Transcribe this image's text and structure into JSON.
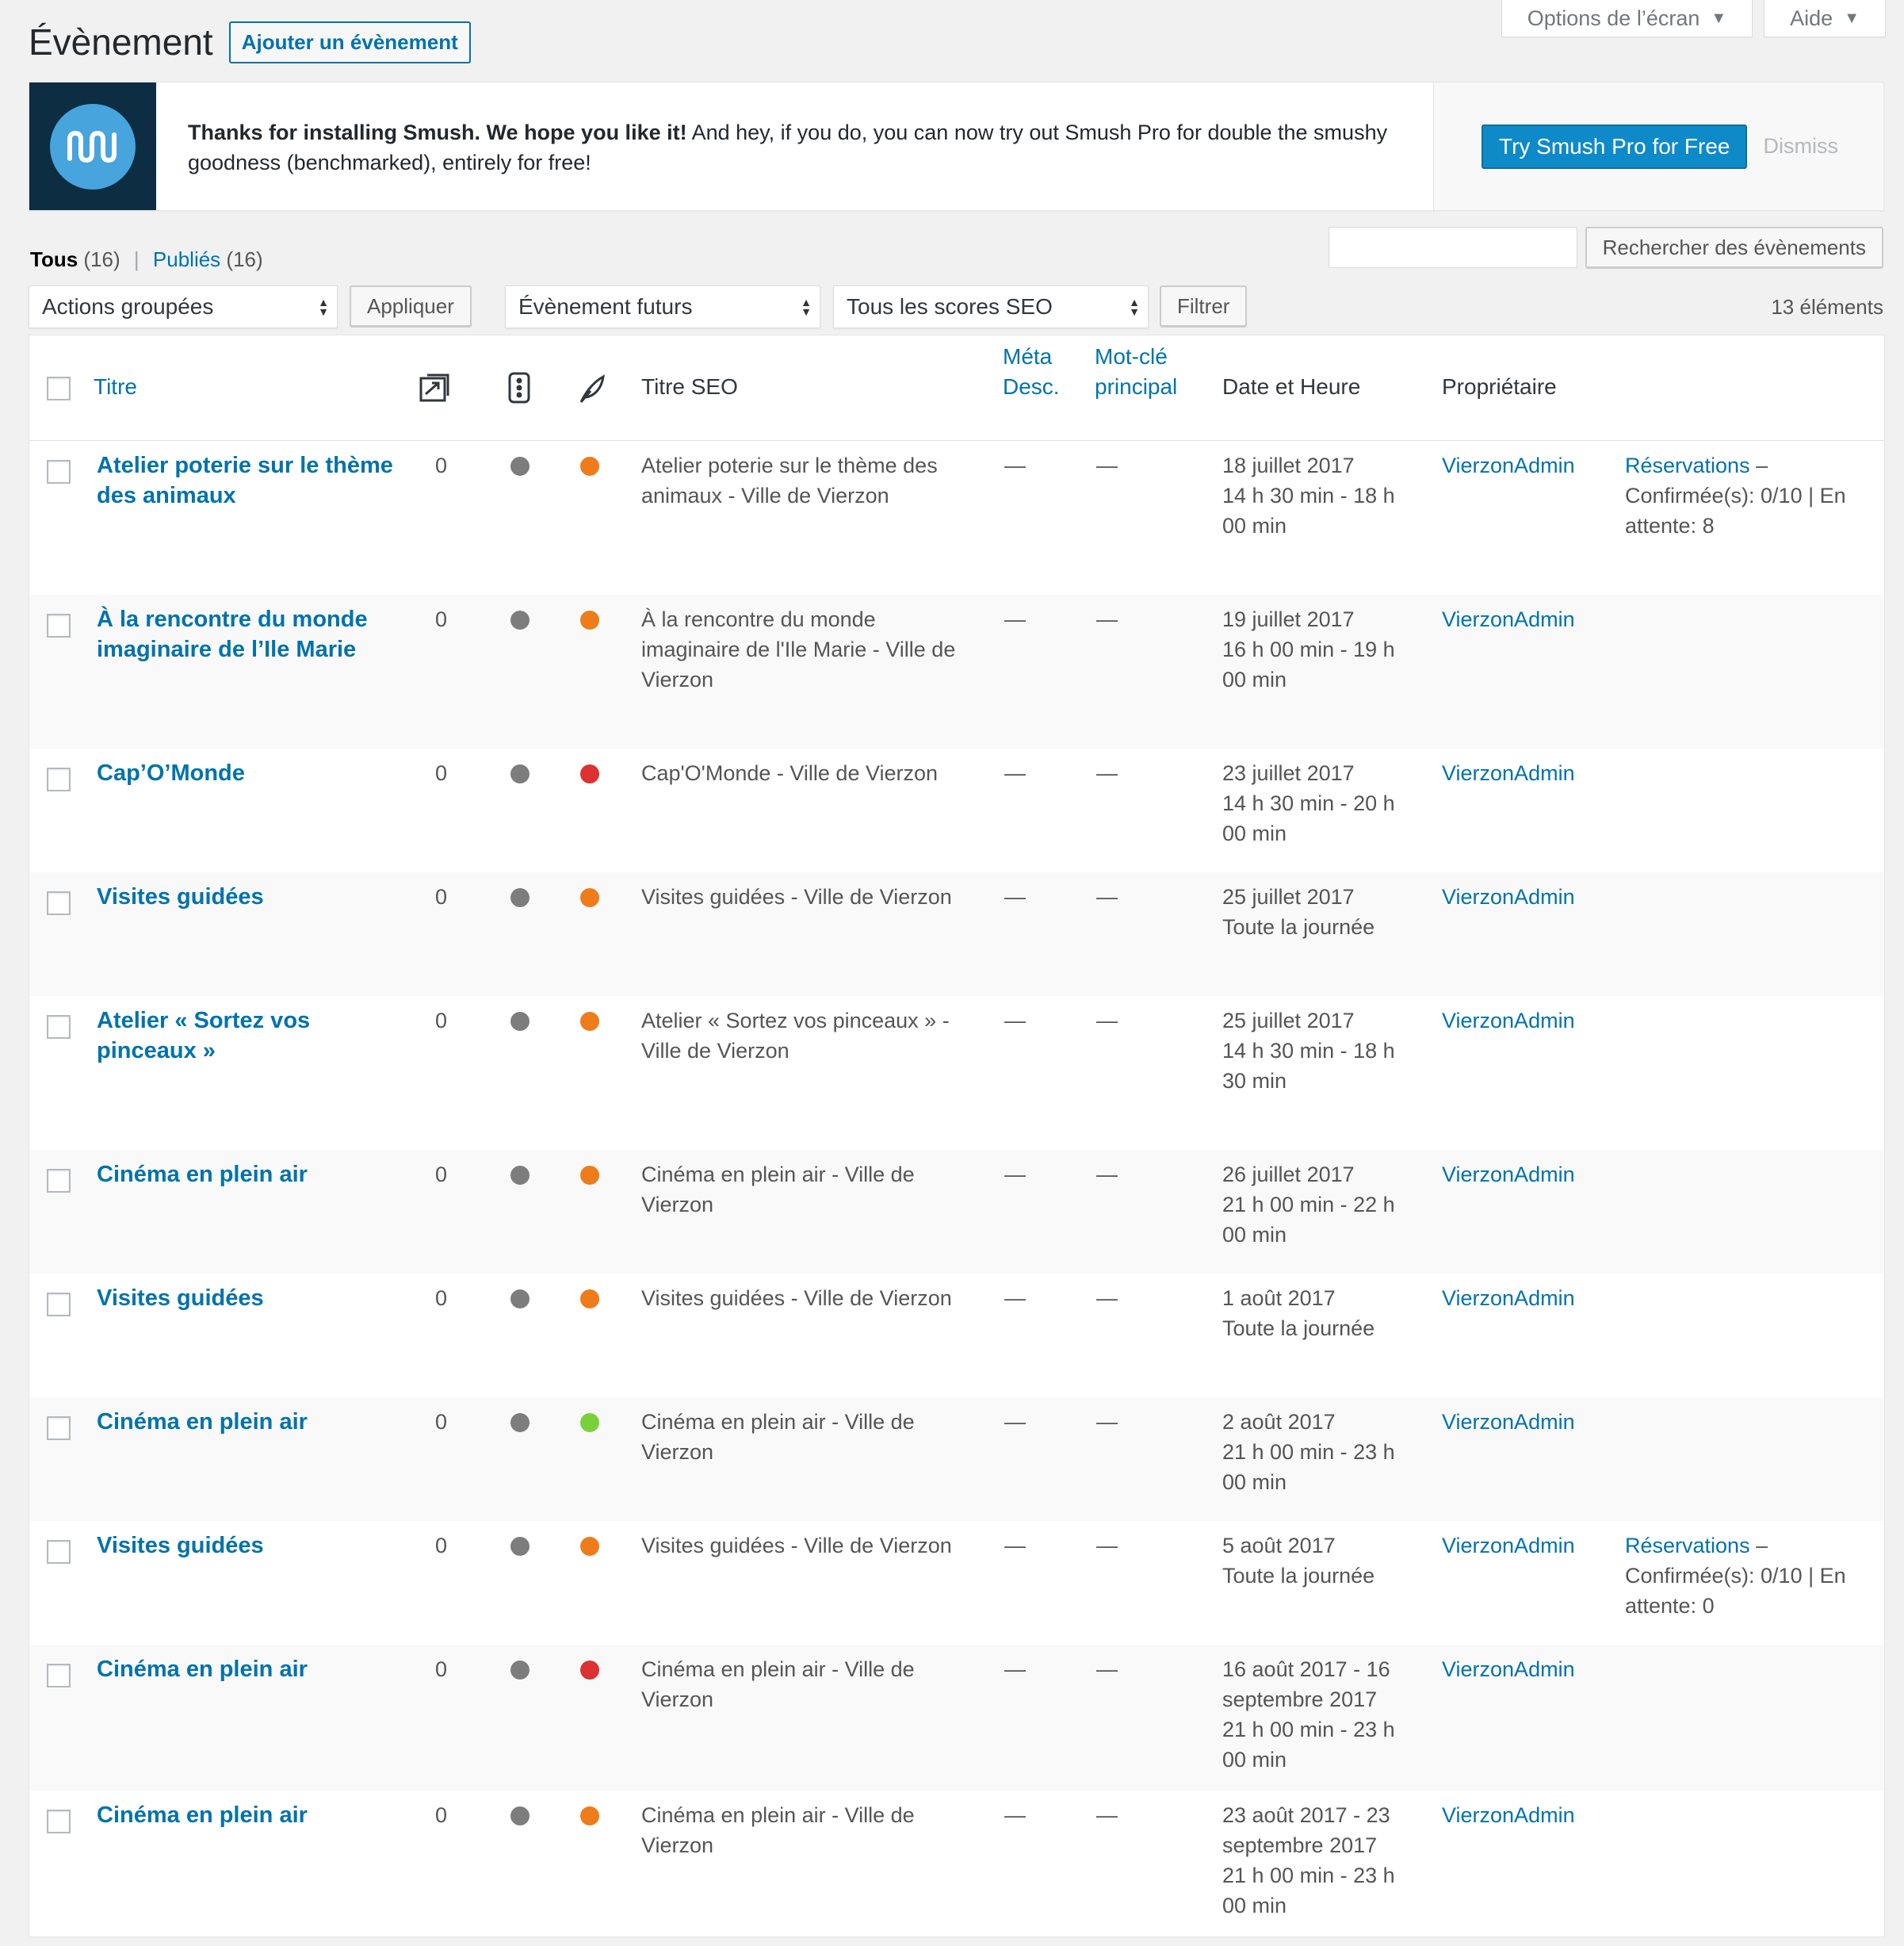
{
  "screen_meta": {
    "options_label": "Options de l’écran",
    "help_label": "Aide"
  },
  "header": {
    "title": "Évènement",
    "add_new_label": "Ajouter un évènement"
  },
  "notice": {
    "bold_text": "Thanks for installing Smush. We hope you like it!",
    "text": " And hey, if you do, you can now try out Smush Pro for double the smushy goodness (benchmarked), entirely for free!",
    "try_button": "Try Smush Pro for Free",
    "dismiss_label": "Dismiss"
  },
  "views": {
    "all_label": "Tous",
    "all_count": "(16)",
    "sep": "|",
    "published_label": "Publiés",
    "published_count": "(16)"
  },
  "search": {
    "value": "",
    "button_label": "Rechercher des évènements"
  },
  "tablenav": {
    "bulk_actions": "Actions groupées",
    "apply_label": "Appliquer",
    "event_filter": "Évènement futurs",
    "seo_filter": "Tous les scores SEO",
    "filter_label": "Filtrer",
    "items_count": "13 éléments"
  },
  "columns": {
    "title": "Titre",
    "links_icon": "link-count-icon",
    "readability_icon": "traffic-light-icon",
    "seo_icon": "feather-icon",
    "seo_title": "Titre SEO",
    "meta_desc_1": "Méta",
    "meta_desc_2": "Desc.",
    "focus_kw_1": "Mot-clé",
    "focus_kw_2": "principal",
    "date": "Date et Heure",
    "owner": "Propriétaire"
  },
  "colors": {
    "gray": "#7d7d7d",
    "orange": "#ee7c1b",
    "red": "#dc3232",
    "green": "#7ad03a",
    "link": "#0073aa"
  },
  "rows": [
    {
      "title_1": "Atelier poterie sur le thème",
      "title_2": "des animaux",
      "links": "0",
      "readability": "gray",
      "seo": "orange",
      "seo_1": "Atelier poterie sur le thème des",
      "seo_2": "animaux - Ville de Vierzon",
      "seo_3": "",
      "meta": "—",
      "kw": "—",
      "date_1": "18 juillet 2017",
      "date_2": "14 h 30 min - 18 h",
      "date_3": "00 min",
      "date_4": "",
      "owner": "VierzonAdmin",
      "res_link": "Réservations",
      "res_1": " –",
      "res_2": "Confirmée(s): 0/10 | En",
      "res_3": "attente: 8"
    },
    {
      "title_1": "À la rencontre du monde",
      "title_2": "imaginaire de l’Ile Marie",
      "links": "0",
      "readability": "gray",
      "seo": "orange",
      "seo_1": "À la rencontre du monde",
      "seo_2": "imaginaire de l'Ile Marie - Ville de",
      "seo_3": "Vierzon",
      "meta": "—",
      "kw": "—",
      "date_1": "19 juillet 2017",
      "date_2": "16 h 00 min - 19 h",
      "date_3": "00 min",
      "date_4": "",
      "owner": "VierzonAdmin",
      "res_link": "",
      "res_1": "",
      "res_2": "",
      "res_3": ""
    },
    {
      "title_1": "Cap’O’Monde",
      "title_2": "",
      "links": "0",
      "readability": "gray",
      "seo": "red",
      "seo_1": "Cap'O'Monde - Ville de Vierzon",
      "seo_2": "",
      "seo_3": "",
      "meta": "—",
      "kw": "—",
      "date_1": "23 juillet 2017",
      "date_2": "14 h 30 min - 20 h",
      "date_3": "00 min",
      "date_4": "",
      "owner": "VierzonAdmin",
      "res_link": "",
      "res_1": "",
      "res_2": "",
      "res_3": ""
    },
    {
      "title_1": "Visites guidées",
      "title_2": "",
      "links": "0",
      "readability": "gray",
      "seo": "orange",
      "seo_1": "Visites guidées - Ville de Vierzon",
      "seo_2": "",
      "seo_3": "",
      "meta": "—",
      "kw": "—",
      "date_1": "25 juillet 2017",
      "date_2": "Toute la journée",
      "date_3": "",
      "date_4": "",
      "owner": "VierzonAdmin",
      "res_link": "",
      "res_1": "",
      "res_2": "",
      "res_3": ""
    },
    {
      "title_1": "Atelier « Sortez vos",
      "title_2": "pinceaux »",
      "links": "0",
      "readability": "gray",
      "seo": "orange",
      "seo_1": "Atelier « Sortez vos pinceaux » -",
      "seo_2": "Ville de Vierzon",
      "seo_3": "",
      "meta": "—",
      "kw": "—",
      "date_1": "25 juillet 2017",
      "date_2": "14 h 30 min - 18 h",
      "date_3": "30 min",
      "date_4": "",
      "owner": "VierzonAdmin",
      "res_link": "",
      "res_1": "",
      "res_2": "",
      "res_3": ""
    },
    {
      "title_1": "Cinéma en plein air",
      "title_2": "",
      "links": "0",
      "readability": "gray",
      "seo": "orange",
      "seo_1": "Cinéma en plein air - Ville de",
      "seo_2": "Vierzon",
      "seo_3": "",
      "meta": "—",
      "kw": "—",
      "date_1": "26 juillet 2017",
      "date_2": "21 h 00 min - 22 h",
      "date_3": "00 min",
      "date_4": "",
      "owner": "VierzonAdmin",
      "res_link": "",
      "res_1": "",
      "res_2": "",
      "res_3": ""
    },
    {
      "title_1": "Visites guidées",
      "title_2": "",
      "links": "0",
      "readability": "gray",
      "seo": "orange",
      "seo_1": "Visites guidées - Ville de Vierzon",
      "seo_2": "",
      "seo_3": "",
      "meta": "—",
      "kw": "—",
      "date_1": "1 août 2017",
      "date_2": "Toute la journée",
      "date_3": "",
      "date_4": "",
      "owner": "VierzonAdmin",
      "res_link": "",
      "res_1": "",
      "res_2": "",
      "res_3": ""
    },
    {
      "title_1": "Cinéma en plein air",
      "title_2": "",
      "links": "0",
      "readability": "gray",
      "seo": "green",
      "seo_1": "Cinéma en plein air - Ville de",
      "seo_2": "Vierzon",
      "seo_3": "",
      "meta": "—",
      "kw": "—",
      "date_1": "2 août 2017",
      "date_2": "21 h 00 min - 23 h",
      "date_3": "00 min",
      "date_4": "",
      "owner": "VierzonAdmin",
      "res_link": "",
      "res_1": "",
      "res_2": "",
      "res_3": ""
    },
    {
      "title_1": "Visites guidées",
      "title_2": "",
      "links": "0",
      "readability": "gray",
      "seo": "orange",
      "seo_1": "Visites guidées - Ville de Vierzon",
      "seo_2": "",
      "seo_3": "",
      "meta": "—",
      "kw": "—",
      "date_1": "5 août 2017",
      "date_2": "Toute la journée",
      "date_3": "",
      "date_4": "",
      "owner": "VierzonAdmin",
      "res_link": "Réservations",
      "res_1": " –",
      "res_2": "Confirmée(s): 0/10 | En",
      "res_3": "attente: 0"
    },
    {
      "title_1": "Cinéma en plein air",
      "title_2": "",
      "links": "0",
      "readability": "gray",
      "seo": "red",
      "seo_1": "Cinéma en plein air - Ville de",
      "seo_2": "Vierzon",
      "seo_3": "",
      "meta": "—",
      "kw": "—",
      "date_1": "16 août 2017 - 16",
      "date_2": "septembre 2017",
      "date_3": "21 h 00 min - 23 h",
      "date_4": "00 min",
      "owner": "VierzonAdmin",
      "res_link": "",
      "res_1": "",
      "res_2": "",
      "res_3": ""
    },
    {
      "title_1": "Cinéma en plein air",
      "title_2": "",
      "links": "0",
      "readability": "gray",
      "seo": "orange",
      "seo_1": "Cinéma en plein air - Ville de",
      "seo_2": "Vierzon",
      "seo_3": "",
      "meta": "—",
      "kw": "—",
      "date_1": "23 août 2017 - 23",
      "date_2": "septembre 2017",
      "date_3": "21 h 00 min - 23 h",
      "date_4": "00 min",
      "owner": "VierzonAdmin",
      "res_link": "",
      "res_1": "",
      "res_2": "",
      "res_3": ""
    }
  ]
}
